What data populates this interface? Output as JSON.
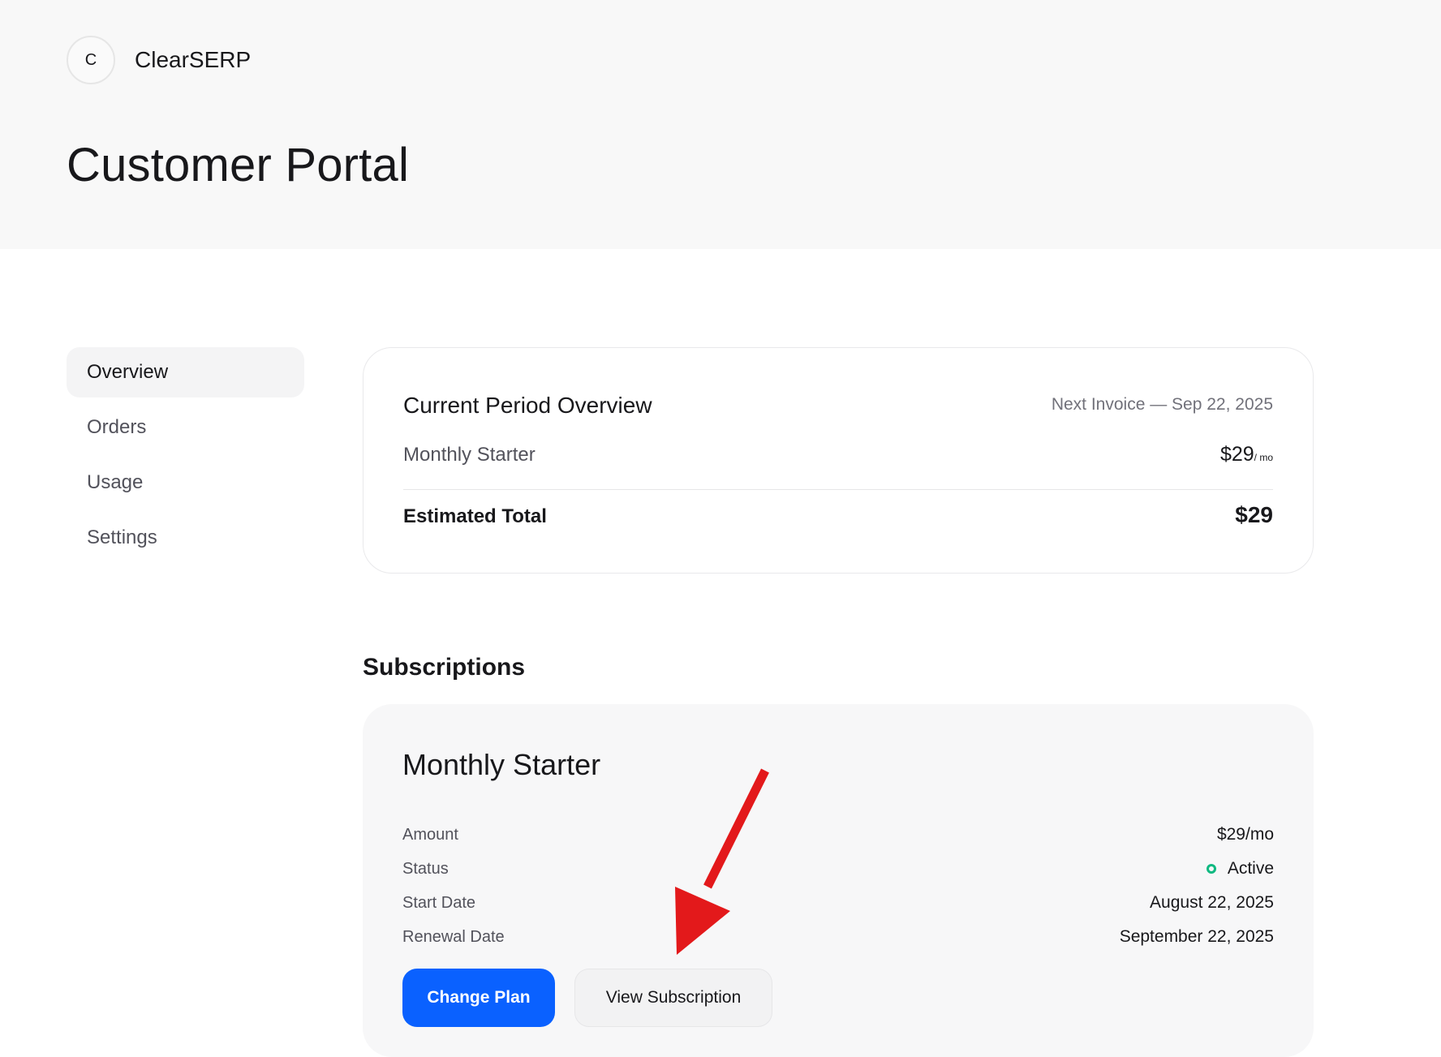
{
  "brand": {
    "initial": "C",
    "name": "ClearSERP"
  },
  "page_title": "Customer Portal",
  "sidebar": {
    "items": [
      {
        "label": "Overview",
        "active": true
      },
      {
        "label": "Orders"
      },
      {
        "label": "Usage"
      },
      {
        "label": "Settings"
      }
    ]
  },
  "overview": {
    "title": "Current Period Overview",
    "next_invoice": "Next Invoice — Sep 22, 2025",
    "plan_name": "Monthly Starter",
    "plan_price": "$29",
    "plan_unit": "/ mo",
    "total_label": "Estimated Total",
    "total_value": "$29"
  },
  "subscriptions": {
    "heading": "Subscriptions",
    "card": {
      "title": "Monthly Starter",
      "rows": [
        {
          "label": "Amount",
          "value": "$29/mo"
        },
        {
          "label": "Status",
          "value": "Active"
        },
        {
          "label": "Start Date",
          "value": "August 22, 2025"
        },
        {
          "label": "Renewal Date",
          "value": "September 22, 2025"
        }
      ],
      "change_plan_label": "Change Plan",
      "view_subscription_label": "View Subscription"
    }
  },
  "colors": {
    "primary": "#0a61ff",
    "status_active": "#10b981",
    "annotation_arrow": "#e3191b"
  },
  "icons": {
    "status": "status-dot-icon",
    "annotation": "red-arrow-icon"
  }
}
